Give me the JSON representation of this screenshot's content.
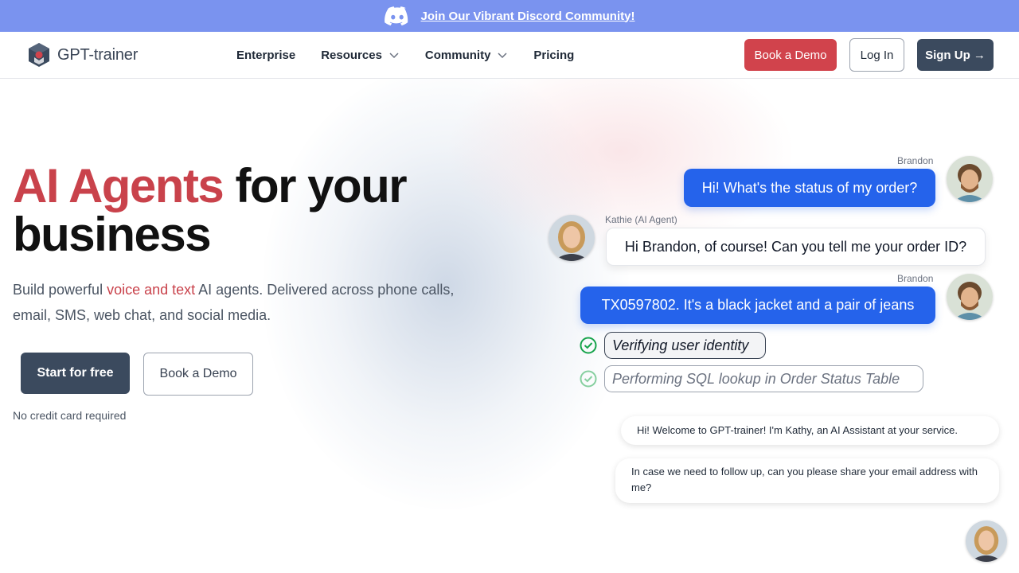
{
  "banner": {
    "text": "Join Our Vibrant Discord Community!"
  },
  "logo": {
    "text": "GPT-trainer"
  },
  "nav": {
    "links": [
      "Enterprise",
      "Resources",
      "Community",
      "Pricing"
    ],
    "book_demo": "Book a Demo",
    "login": "Log In",
    "signup": "Sign Up →"
  },
  "hero": {
    "title_accent": "AI Agents",
    "title_rest": " for your business",
    "sub_pre": "Build powerful ",
    "sub_accent": "voice and text",
    "sub_post": " AI agents. Delivered across phone calls, email, SMS, web chat, and social media.",
    "start": "Start for free",
    "demo": "Book a Demo",
    "note": "No credit card required"
  },
  "chat": {
    "user_name": "Brandon",
    "agent_name": "Kathie (AI Agent)",
    "msg1": "Hi! What's the status of my order?",
    "msg2": "Hi Brandon, of course! Can you tell me your order ID?",
    "msg3": "TX0597802. It's a black jacket and a pair of jeans",
    "status1": "Verifying user identity",
    "status2": "Performing SQL lookup in Order Status Table"
  },
  "widget": {
    "msg1": "Hi! Welcome to GPT-trainer! I'm Kathy, an AI Assistant at your service.",
    "msg2": "In case we need to follow up, can you please share your email address with me?"
  },
  "colors": {
    "banner": "#7a93ef",
    "accent": "#c9424b",
    "primary": "#3b4a5e",
    "chat_blue": "#2563eb"
  }
}
